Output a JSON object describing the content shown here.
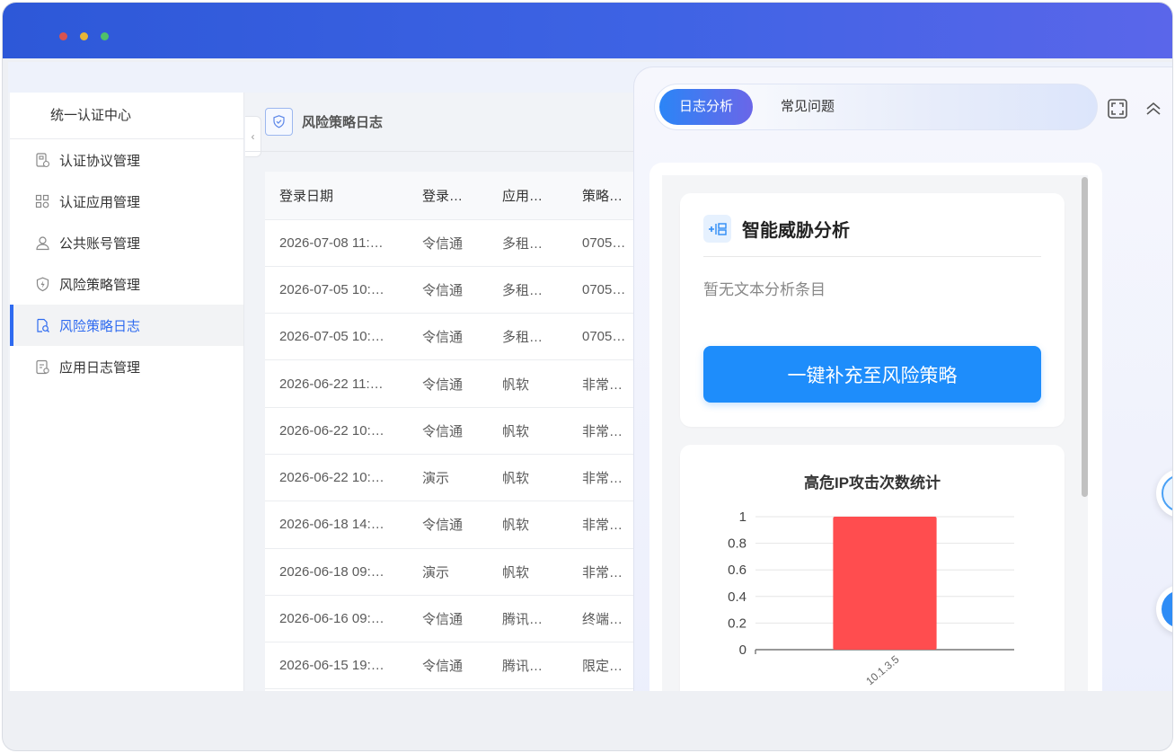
{
  "sidebar": {
    "title": "统一认证中心",
    "items": [
      {
        "label": "认证协议管理",
        "icon": "protocol-doc-icon"
      },
      {
        "label": "认证应用管理",
        "icon": "apps-grid-icon"
      },
      {
        "label": "公共账号管理",
        "icon": "user-icon"
      },
      {
        "label": "风险策略管理",
        "icon": "shield-bolt-icon"
      },
      {
        "label": "风险策略日志",
        "icon": "log-search-icon",
        "active": true
      },
      {
        "label": "应用日志管理",
        "icon": "app-log-icon"
      }
    ]
  },
  "page": {
    "title": "风险策略日志"
  },
  "table": {
    "headers": [
      "登录日期",
      "登录…",
      "应用…",
      "策略…"
    ],
    "rows": [
      [
        "2026-07-08 11:…",
        "令信通",
        "多租…",
        "0705…"
      ],
      [
        "2026-07-05 10:…",
        "令信通",
        "多租…",
        "0705…"
      ],
      [
        "2026-07-05 10:…",
        "令信通",
        "多租…",
        "0705…"
      ],
      [
        "2026-06-22 11:…",
        "令信通",
        "帆软",
        "非常…"
      ],
      [
        "2026-06-22 10:…",
        "令信通",
        "帆软",
        "非常…"
      ],
      [
        "2026-06-22 10:…",
        "演示",
        "帆软",
        "非常…"
      ],
      [
        "2026-06-18 14:…",
        "令信通",
        "帆软",
        "非常…"
      ],
      [
        "2026-06-18 09:…",
        "演示",
        "帆软",
        "非常…"
      ],
      [
        "2026-06-16 09:…",
        "令信通",
        "腾讯…",
        "终端…"
      ],
      [
        "2026-06-15 19:…",
        "令信通",
        "腾讯…",
        "限定…"
      ]
    ]
  },
  "panel": {
    "tabs": [
      {
        "label": "日志分析",
        "active": true
      },
      {
        "label": "常见问题",
        "active": false
      }
    ],
    "ai_card": {
      "title": "智能威胁分析",
      "empty_text": "暂无文本分析条目",
      "button_label": "一键补充至风险策略"
    }
  },
  "chart_data": {
    "type": "bar",
    "title": "高危IP攻击次数统计",
    "categories": [
      "10.1.3.5"
    ],
    "values": [
      1
    ],
    "ylim": [
      0,
      1
    ],
    "yticks": [
      "0",
      "0.2",
      "0.4",
      "0.6",
      "0.8",
      "1"
    ],
    "bar_color": "#ff4d4f",
    "grid": true
  },
  "colors": {
    "accent": "#2f6bf0",
    "primary_button": "#1e8dfb",
    "titlebar": "#3e63e4"
  }
}
